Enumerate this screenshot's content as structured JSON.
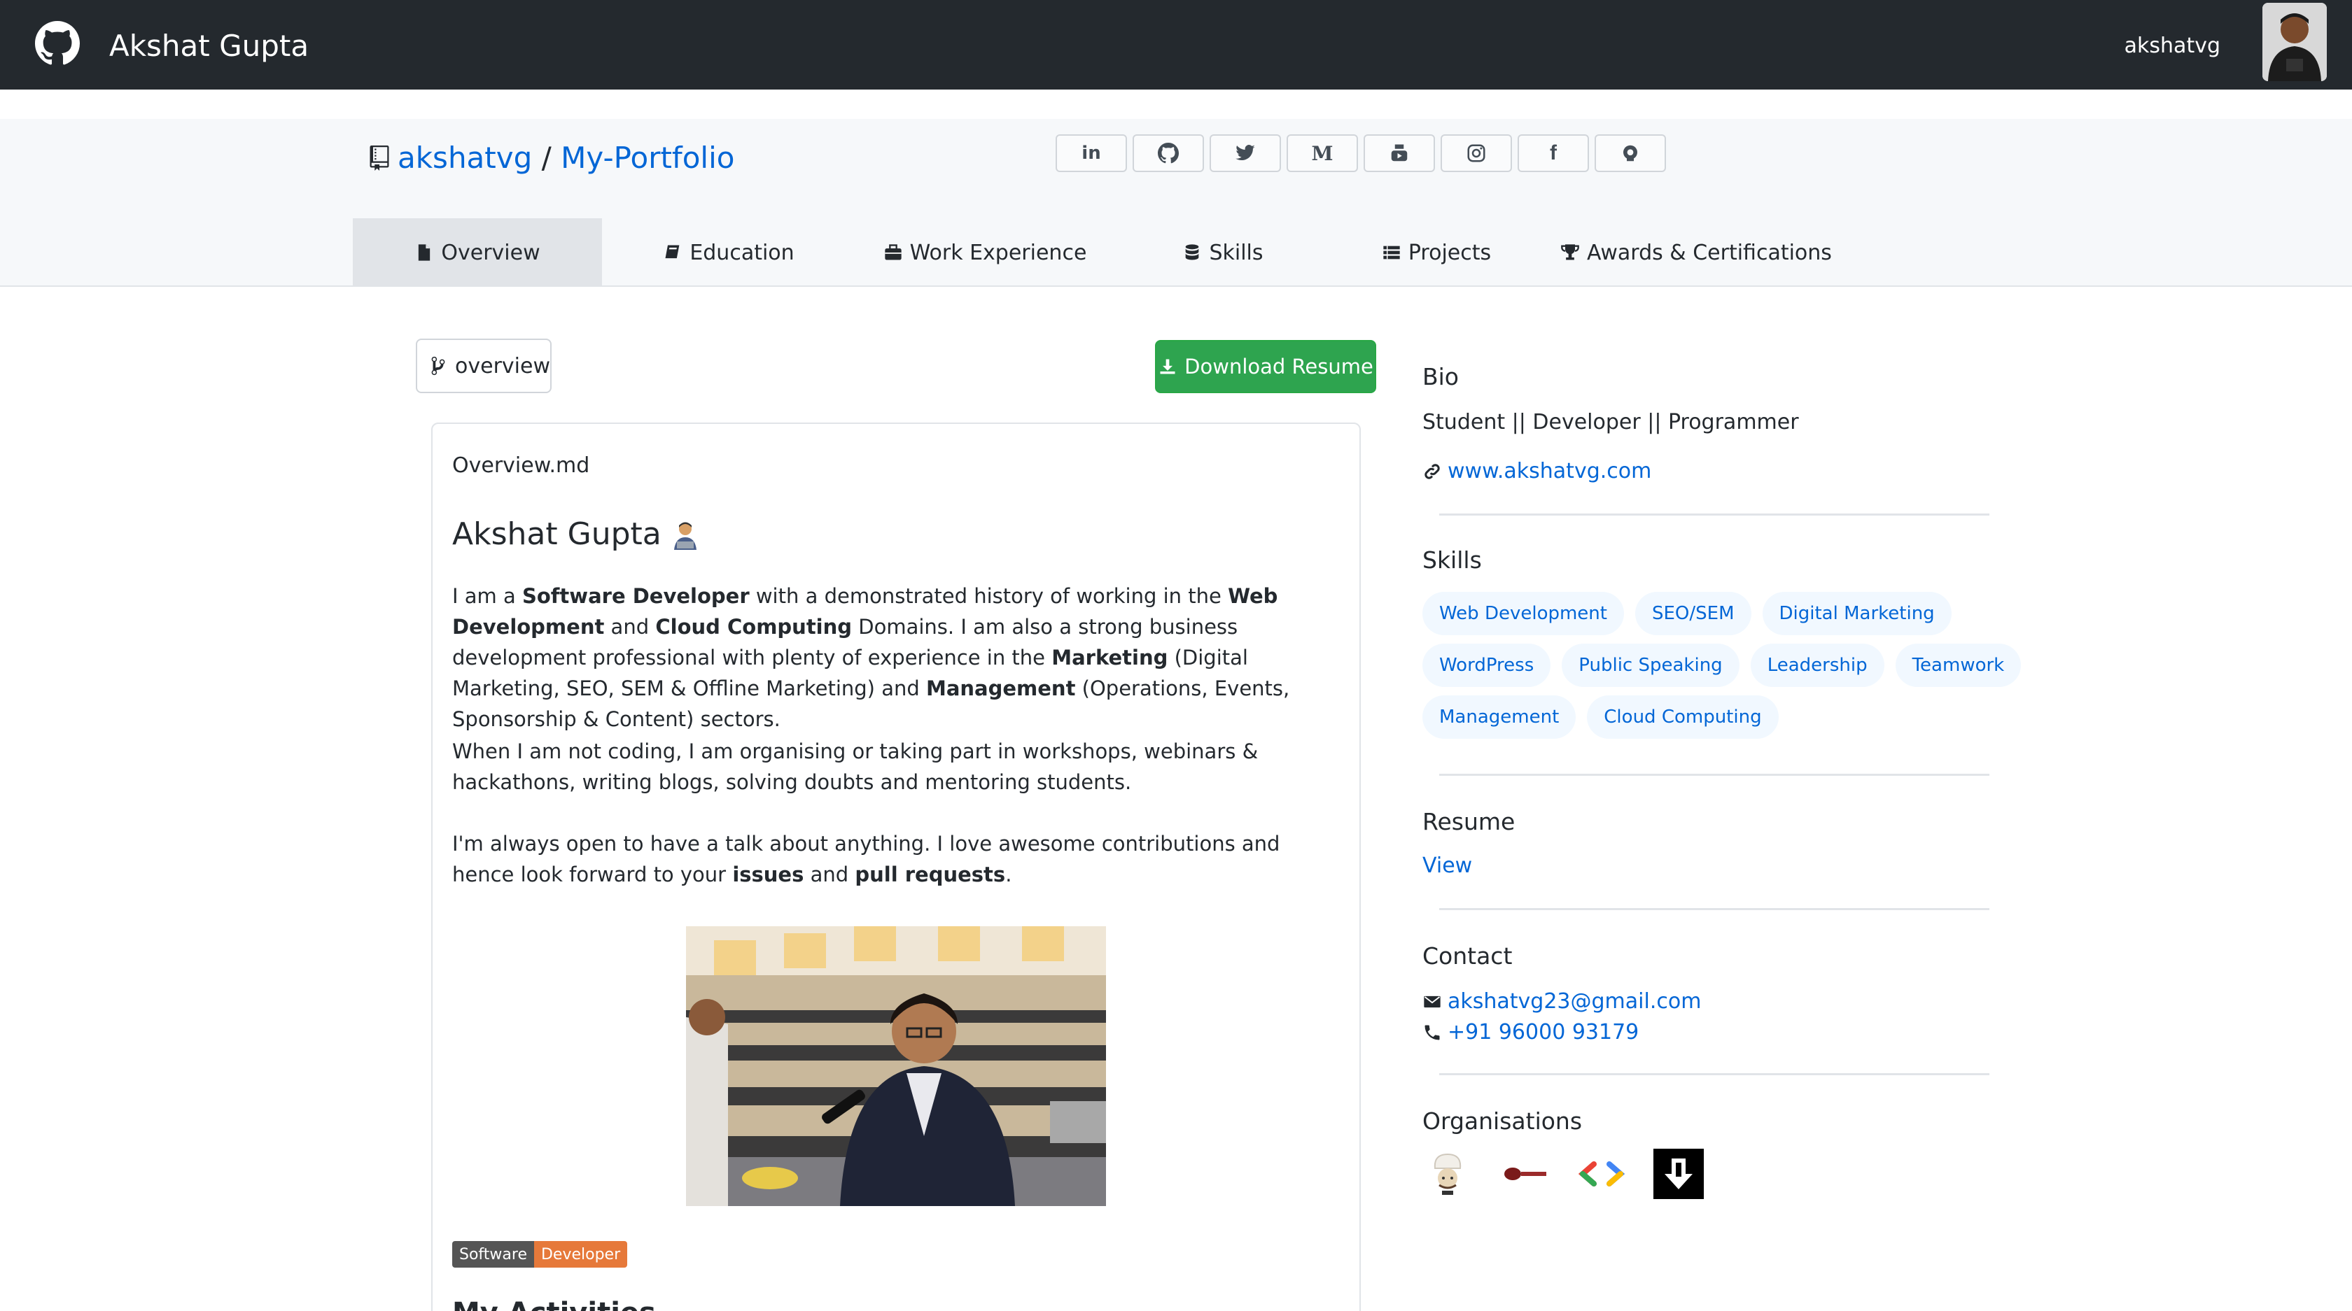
{
  "topbar": {
    "title": "Akshat Gupta",
    "username": "akshatvg"
  },
  "repo": {
    "owner": "akshatvg",
    "separator": "/",
    "name": "My-Portfolio"
  },
  "social": [
    "in",
    "github",
    "twitter",
    "medium",
    "youtube",
    "instagram",
    "facebook",
    "codechef"
  ],
  "tabs": [
    {
      "label": "Overview",
      "icon": "file-icon",
      "active": true
    },
    {
      "label": "Education",
      "icon": "book-icon"
    },
    {
      "label": "Work Experience",
      "icon": "briefcase-icon"
    },
    {
      "label": "Skills",
      "icon": "database-icon"
    },
    {
      "label": "Projects",
      "icon": "list-icon"
    },
    {
      "label": "Awards & Certifications",
      "icon": "trophy-icon"
    }
  ],
  "branch": {
    "label": "overview"
  },
  "download": {
    "label": "Download Resume"
  },
  "readme": {
    "filename": "Overview.md",
    "heading": "Akshat Gupta",
    "p1": {
      "t1": "I am a ",
      "b1": "Software Developer",
      "t2": " with a demonstrated history of working in the ",
      "b2": "Web Development",
      "t3": " and ",
      "b3": "Cloud Computing",
      "t4": " Domains. I am also a strong business development professional with plenty of experience in the ",
      "b4": "Marketing",
      "t5": " (Digital Marketing, SEO, SEM & Offline Marketing) and ",
      "b5": "Management",
      "t6": " (Operations, Events, Sponsorship & Content) sectors."
    },
    "p2": "When I am not coding, I am organising or taking part in workshops, webinars & hackathons, writing blogs, solving doubts and mentoring students.",
    "p3": {
      "t1": "I'm always open to have a talk about anything. I love awesome contributions and hence look forward to your ",
      "b1": "issues",
      "t2": " and ",
      "b2": "pull requests",
      "t3": "."
    },
    "badge": {
      "left": "Software",
      "right": "Developer"
    },
    "h2_partial": "My Activities"
  },
  "sidebar": {
    "bio_title": "Bio",
    "bio_text": "Student || Developer || Programmer",
    "website": "www.akshatvg.com",
    "skills_title": "Skills",
    "skills": [
      [
        "Web Development",
        "SEO/SEM",
        "Digital Marketing"
      ],
      [
        "WordPress",
        "Public Speaking",
        "Leadership",
        "Teamwork"
      ],
      [
        "Management",
        "Cloud Computing"
      ]
    ],
    "resume_title": "Resume",
    "resume_link": "View",
    "contact_title": "Contact",
    "email": "akshatvg23@gmail.com",
    "phone": "+91 96000 93179",
    "orgs_title": "Organisations",
    "orgs": [
      "codechef-chapter",
      "red-org",
      "google-dsc",
      "dev-org"
    ]
  },
  "colors": {
    "topbar": "#24292e",
    "link": "#0366d6",
    "download": "#2ea44f",
    "pill_bg": "#f1f8ff"
  }
}
